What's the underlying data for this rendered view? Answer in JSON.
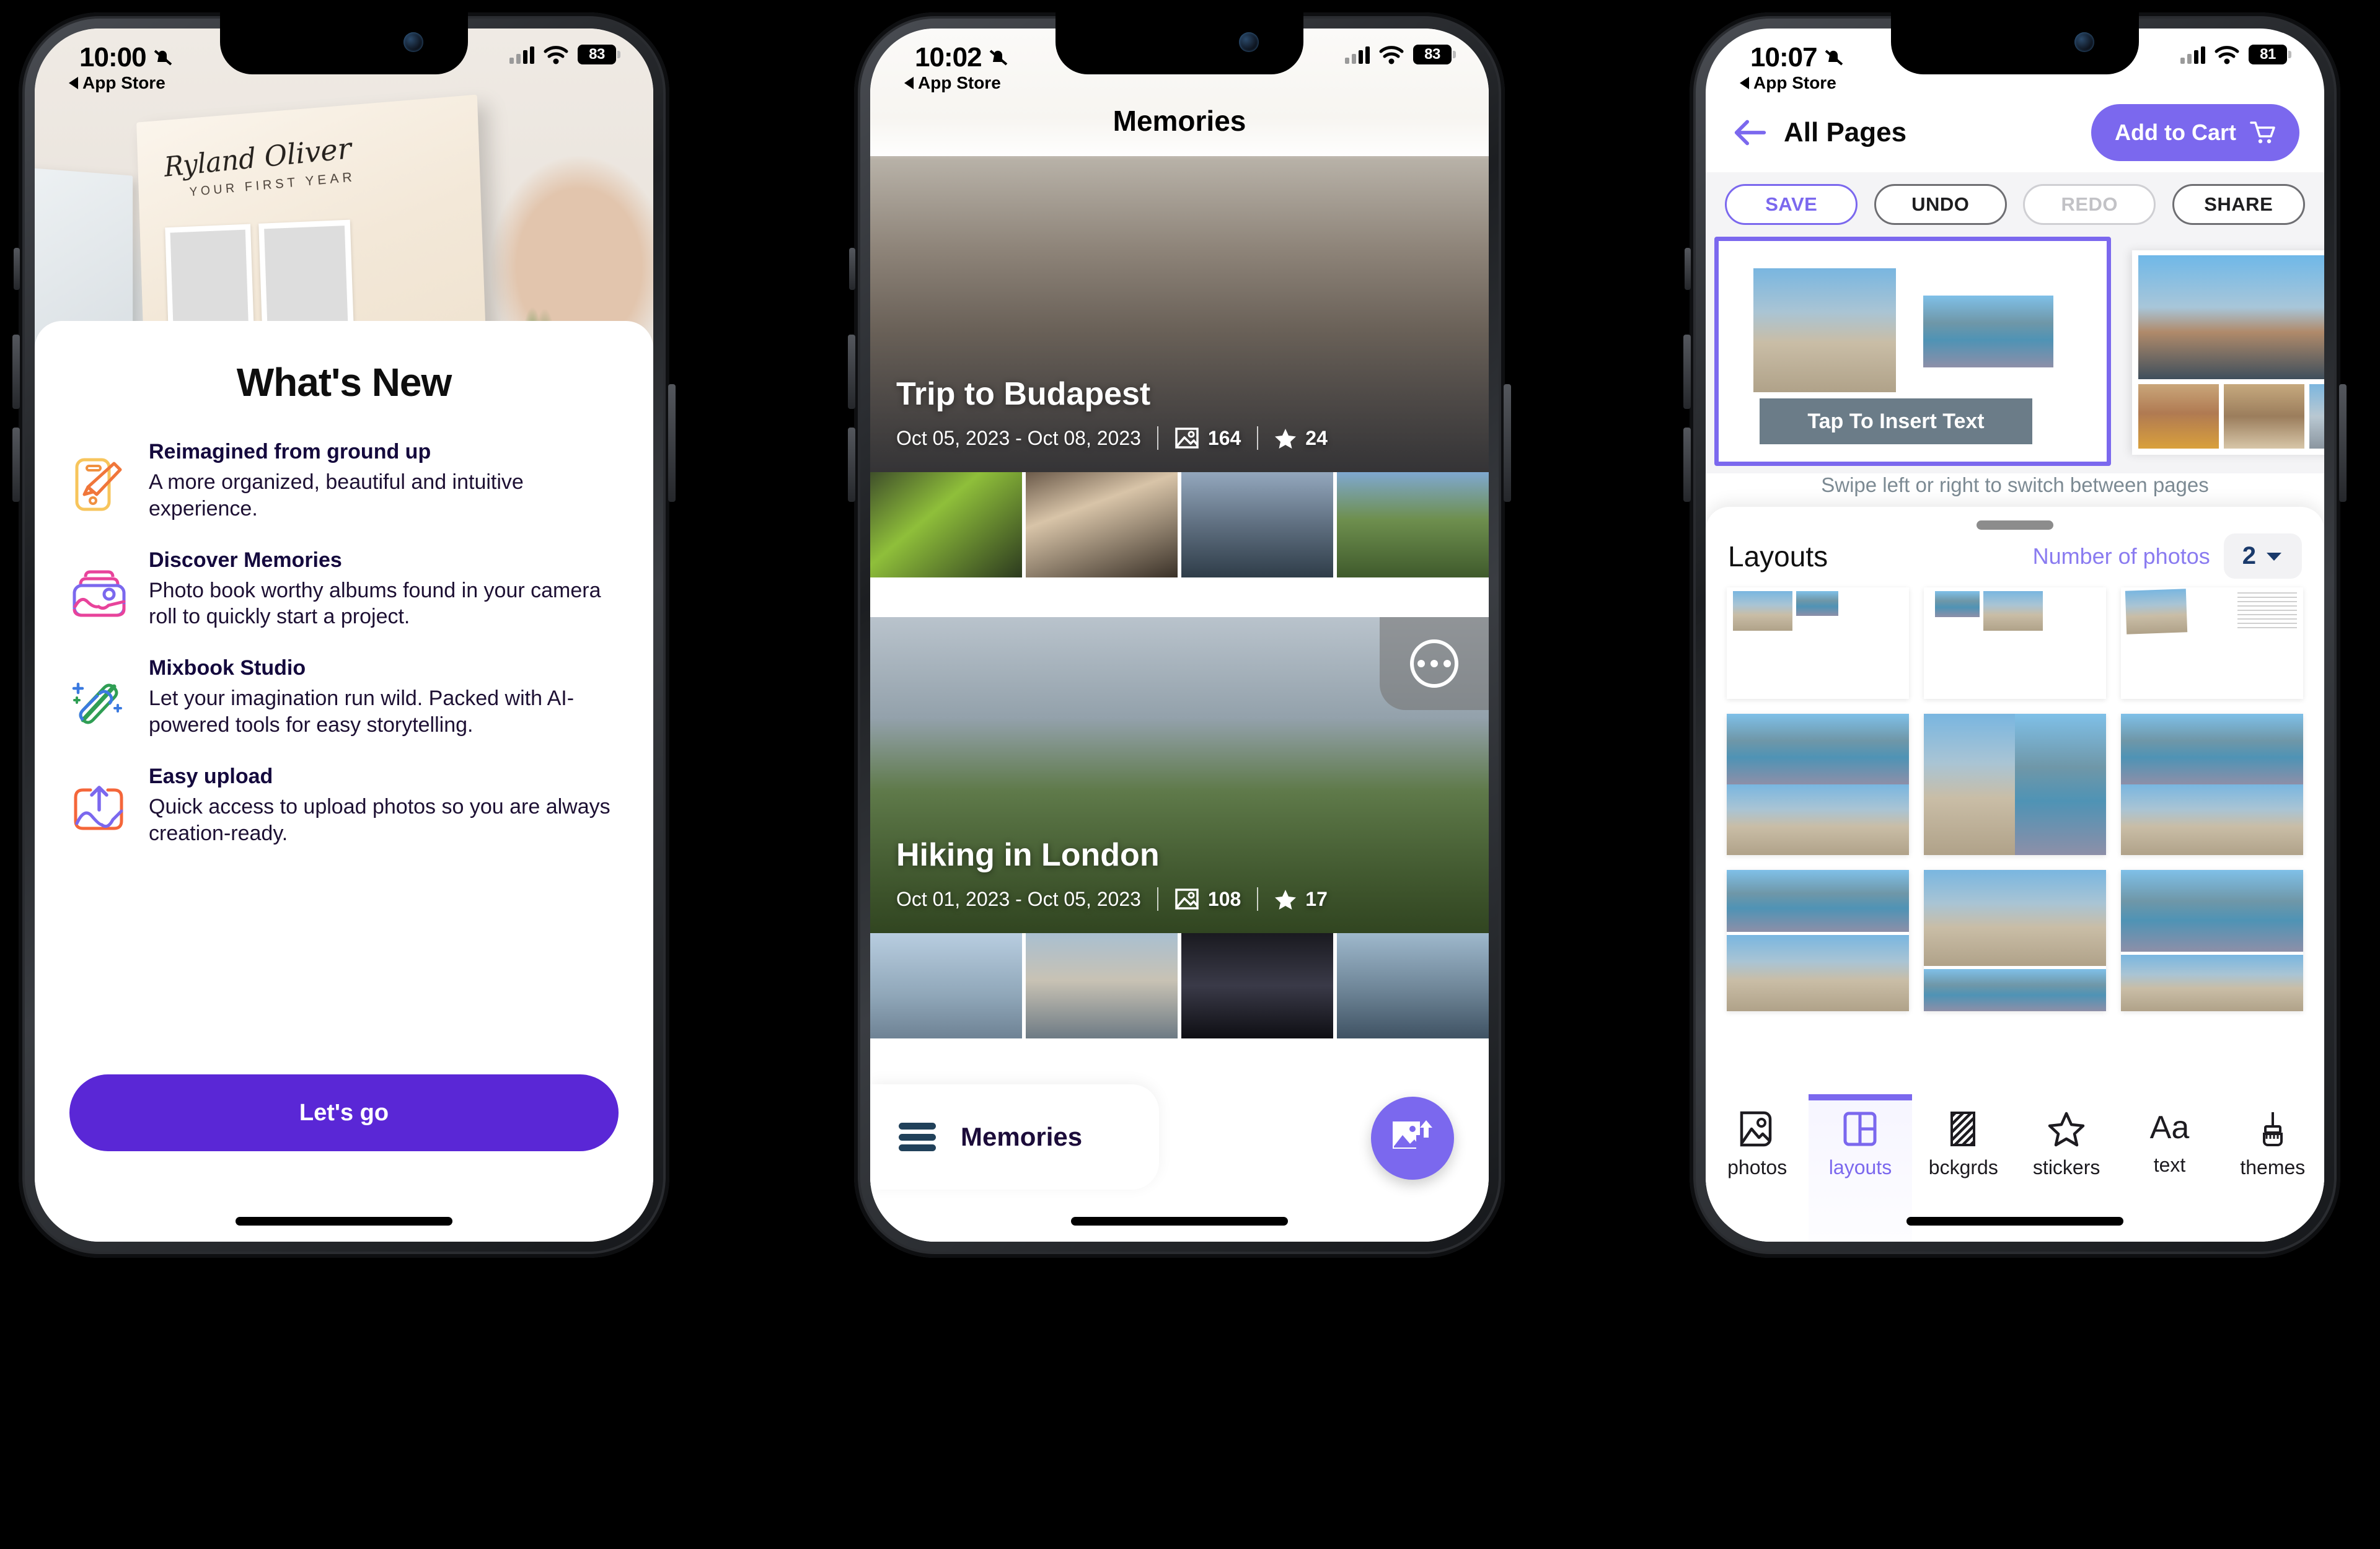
{
  "phones": [
    {
      "id": "phone-onboarding",
      "status": {
        "time": "10:00",
        "back_link": "App Store",
        "battery": "83",
        "silent_icon": "bell-slash-icon",
        "wifi_icon": "wifi-icon",
        "signal_icon": "cellular-icon"
      },
      "hero": {
        "book_title": "Ryland Oliver",
        "book_subtitle": "YOUR FIRST YEAR"
      },
      "sheet": {
        "title": "What's New",
        "features": [
          {
            "icon": "phone-paintbrush-icon",
            "heading": "Reimagined from ground up",
            "body": "A more organized, beautiful and intuitive experience."
          },
          {
            "icon": "photo-album-icon",
            "heading": "Discover Memories",
            "body": "Photo book worthy albums found in your camera roll to quickly start a project."
          },
          {
            "icon": "magic-wand-sparkle-icon",
            "heading": "Mixbook Studio",
            "body": "Let your imagination run wild. Packed with AI-powered tools for easy storytelling."
          },
          {
            "icon": "upload-photo-icon",
            "heading": "Easy upload",
            "body": "Quick access to upload photos so you are always creation-ready."
          }
        ],
        "cta_label": "Let's go"
      }
    },
    {
      "id": "phone-memories",
      "status": {
        "time": "10:02",
        "back_link": "App Store",
        "battery": "83"
      },
      "header_title": "Memories",
      "memories": [
        {
          "name": "Trip to Budapest",
          "date_range": "Oct 05, 2023 - Oct 08, 2023",
          "photo_count": "164",
          "favorite_count": "24",
          "photo_icon": "photo-icon",
          "star_icon": "star-icon",
          "has_more_button": false
        },
        {
          "name": "Hiking in London",
          "date_range": "Oct 01, 2023 - Oct 05, 2023",
          "photo_count": "108",
          "favorite_count": "17",
          "photo_icon": "photo-icon",
          "star_icon": "star-icon",
          "has_more_button": true,
          "more_icon": "ellipsis-icon"
        }
      ],
      "bottom_bar": {
        "menu_icon": "hamburger-menu-icon",
        "label": "Memories",
        "fab_icon": "upload-photo-icon"
      }
    },
    {
      "id": "phone-editor",
      "status": {
        "time": "10:07",
        "back_link": "App Store",
        "battery": "81"
      },
      "nav": {
        "back_icon": "arrow-left-icon",
        "title": "All Pages",
        "cart_label": "Add to Cart",
        "cart_icon": "shopping-cart-icon"
      },
      "toolbar": [
        {
          "label": "SAVE",
          "state": "active"
        },
        {
          "label": "UNDO",
          "state": "normal"
        },
        {
          "label": "REDO",
          "state": "disabled"
        },
        {
          "label": "SHARE",
          "state": "normal"
        }
      ],
      "canvas": {
        "text_placeholder": "Tap To Insert Text"
      },
      "swipe_hint": "Swipe left or right to switch between pages",
      "layouts_panel": {
        "title": "Layouts",
        "number_of_photos_label": "Number of photos",
        "number_of_photos_value": "2",
        "chevron_icon": "chevron-down-icon"
      },
      "tabs": [
        {
          "label": "photos",
          "icon": "photos-icon",
          "selected": false
        },
        {
          "label": "layouts",
          "icon": "layouts-icon",
          "selected": true
        },
        {
          "label": "bckgrds",
          "icon": "backgrounds-icon",
          "selected": false
        },
        {
          "label": "stickers",
          "icon": "star-outline-icon",
          "selected": false
        },
        {
          "label": "text",
          "icon": "text-aa-icon",
          "selected": false
        },
        {
          "label": "themes",
          "icon": "paintbrush-icon",
          "selected": false
        }
      ]
    }
  ],
  "colors": {
    "accent_purple": "#5a27d6",
    "light_purple": "#7b68ee",
    "page_bg": "#000000",
    "text_dark": "#14093d"
  }
}
